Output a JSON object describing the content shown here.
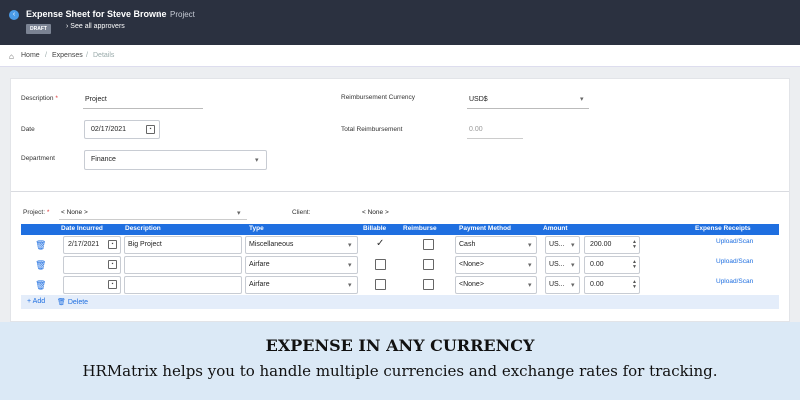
{
  "header": {
    "title": "Expense Sheet for Steve Browne",
    "separator": "/",
    "crumb": "Project",
    "badge": "DRAFT",
    "approvers_link": "See all approvers",
    "approvers_chevron": "›"
  },
  "breadcrumb": {
    "home": "Home",
    "sep": "/",
    "expenses": "Expenses",
    "details": "Details"
  },
  "form": {
    "description_label": "Description",
    "required_mark": "*",
    "description_value": "Project",
    "date_label": "Date",
    "date_value": "02/17/2021",
    "department_label": "Department",
    "department_value": "Finance",
    "currency_label": "Reimbursement Currency",
    "currency_value": "USD$",
    "total_label": "Total Reimbursement",
    "total_value": "0.00",
    "project_label": "Project:",
    "project_value": "< None >",
    "client_label": "Client:",
    "client_value": "< None >"
  },
  "table": {
    "columns": [
      "Date Incurred",
      "Description",
      "Type",
      "Billable",
      "Reimburse",
      "Payment Method",
      "Amount",
      "Expense Receipts"
    ],
    "rows": [
      {
        "date": "2/17/2021",
        "description": "Big Project",
        "type": "Miscellaneous",
        "billable": true,
        "reimburse": false,
        "payment": "Cash",
        "currency": "US...",
        "amount": "200.00",
        "receipt": "Upload/Scan"
      },
      {
        "date": "",
        "description": "",
        "type": "Airfare",
        "billable": false,
        "reimburse": false,
        "payment": "<None>",
        "currency": "US...",
        "amount": "0.00",
        "receipt": "Upload/Scan"
      },
      {
        "date": "",
        "description": "",
        "type": "Airfare",
        "billable": false,
        "reimburse": false,
        "payment": "<None>",
        "currency": "US...",
        "amount": "0.00",
        "receipt": "Upload/Scan"
      }
    ],
    "add_label": "Add",
    "delete_label": "Delete"
  },
  "banner": {
    "headline": "EXPENSE IN ANY CURRENCY",
    "subline": "HRMatrix  helps you to handle multiple currencies and exchange rates for tracking."
  },
  "colors": {
    "topbar": "#2b3140",
    "accent": "#1f6fe0",
    "banner": "#dbe9f6"
  }
}
